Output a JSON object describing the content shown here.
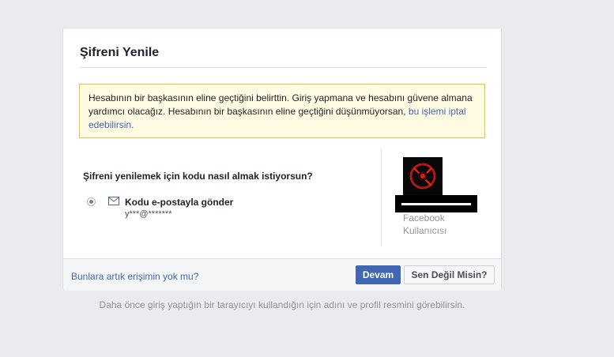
{
  "dialog": {
    "title": "Şifreni Yenile",
    "warning": {
      "text": "Hesabının bir başkasının eline geçtiğini belirttin. Giriş yapmana ve hesabını güvene almana yardımcı olacağız. Hesabının bir başkasının eline geçtiğini düşünmüyorsan, ",
      "link": "bu işlemi iptal edebilirsin."
    },
    "question": "Şifreni yenilemek için kodu nasıl almak istiyorsun?",
    "option": {
      "label": "Kodu e-postayla gönder",
      "email": "y***@*******",
      "selected": true,
      "icon": "mail-icon"
    },
    "profile": {
      "line1": "Facebook",
      "line2": "Kullanıcısı"
    },
    "footer": {
      "link": "Bunlara artık erişimin yok mu?",
      "continue_label": "Devam",
      "not_you_label": "Sen Değil Misin?"
    }
  },
  "note": "Daha önce giriş yaptığın bir tarayıcıyı kullandığın için adını ve profil resmini görebilirsin.",
  "colors": {
    "accent": "#4267b2",
    "warning_bg": "#fffbe2",
    "warning_border": "#e5c73c",
    "page_bg": "#e9ebee"
  }
}
